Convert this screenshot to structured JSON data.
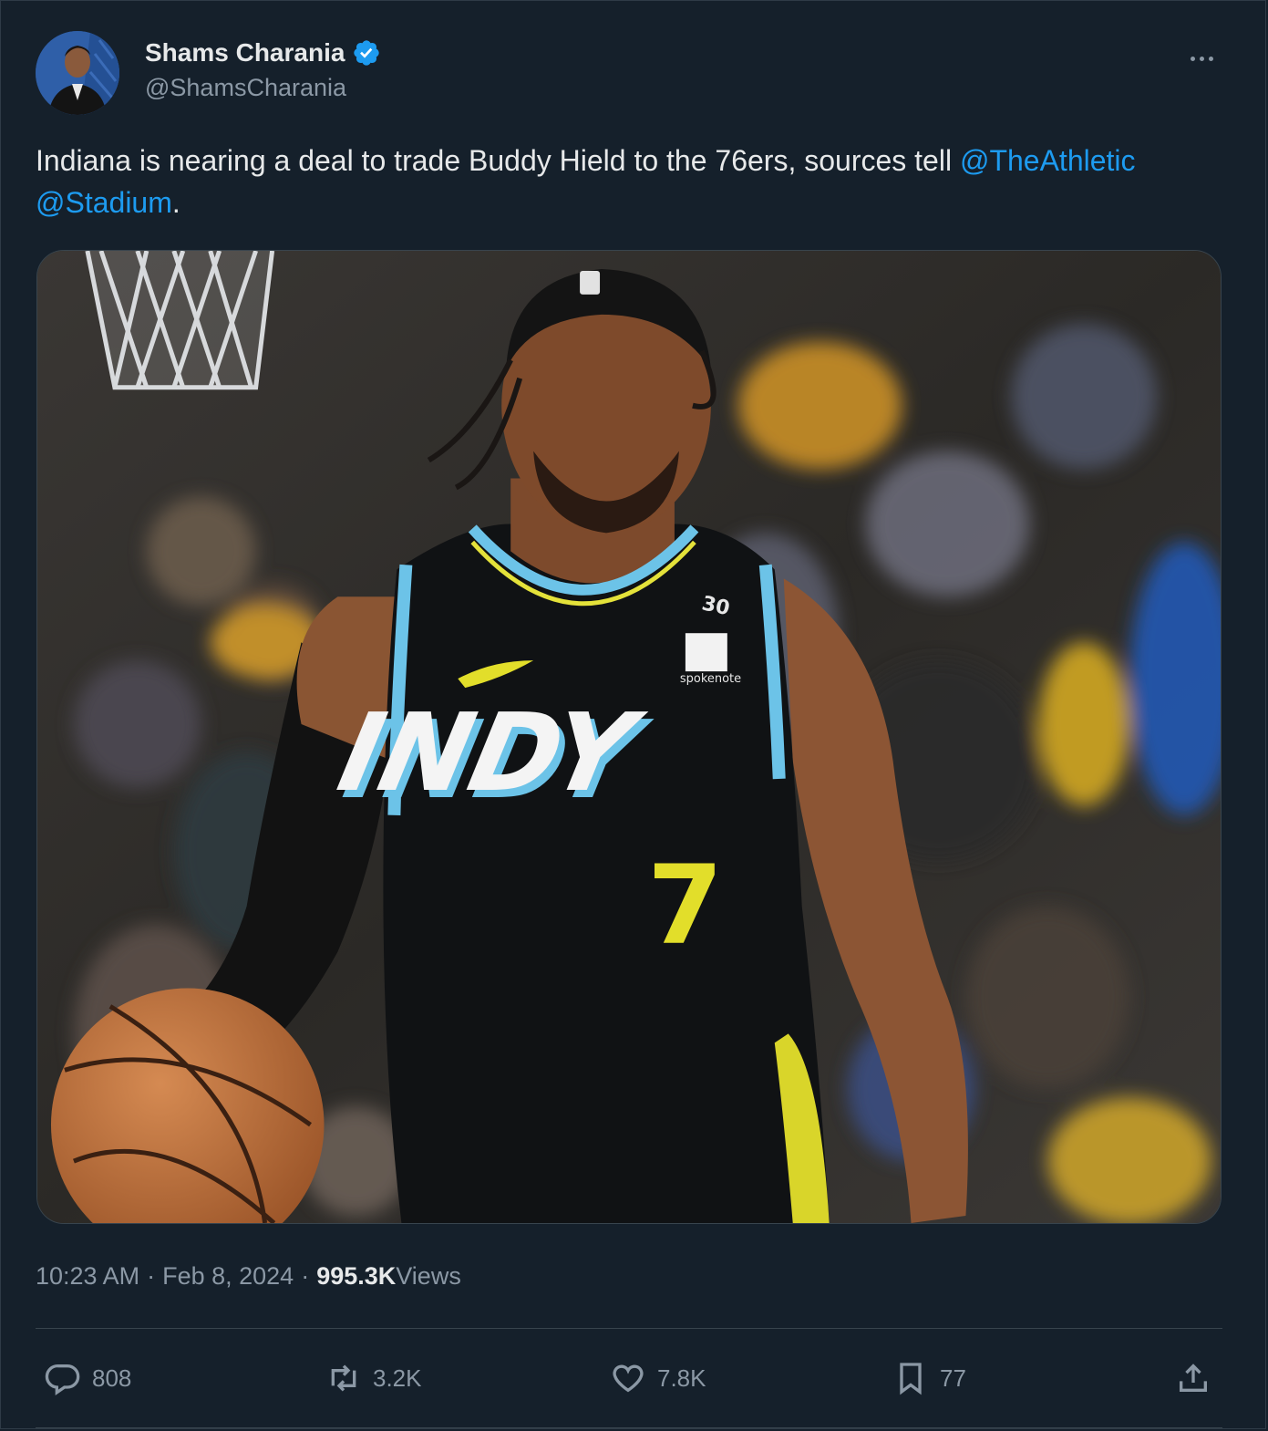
{
  "author": {
    "display_name": "Shams Charania",
    "handle": "@ShamsCharania",
    "verified": true
  },
  "tweet": {
    "text_before": "Indiana is nearing a deal to trade Buddy Hield to the 76ers, sources tell ",
    "mentions": [
      "@TheAthletic",
      "@Stadium"
    ],
    "text_after": "."
  },
  "media": {
    "jersey_wordmark": "INDY",
    "jersey_number": "7",
    "jersey_patch": "30",
    "sponsor": "spokenote"
  },
  "meta": {
    "time": "10:23 AM",
    "date": "Feb 8, 2024",
    "views_count": "995.3K",
    "views_label": "Views"
  },
  "actions": {
    "replies": "808",
    "reposts": "3.2K",
    "likes": "7.8K",
    "bookmarks": "77"
  },
  "colors": {
    "background": "#15202b",
    "link": "#1d9bf0",
    "secondary_text": "#8b98a5",
    "verified": "#1d9bf0"
  },
  "icons": {
    "more": "more-horizontal-icon",
    "reply": "reply-icon",
    "repost": "repost-icon",
    "like": "heart-icon",
    "bookmark": "bookmark-icon",
    "share": "share-icon"
  }
}
